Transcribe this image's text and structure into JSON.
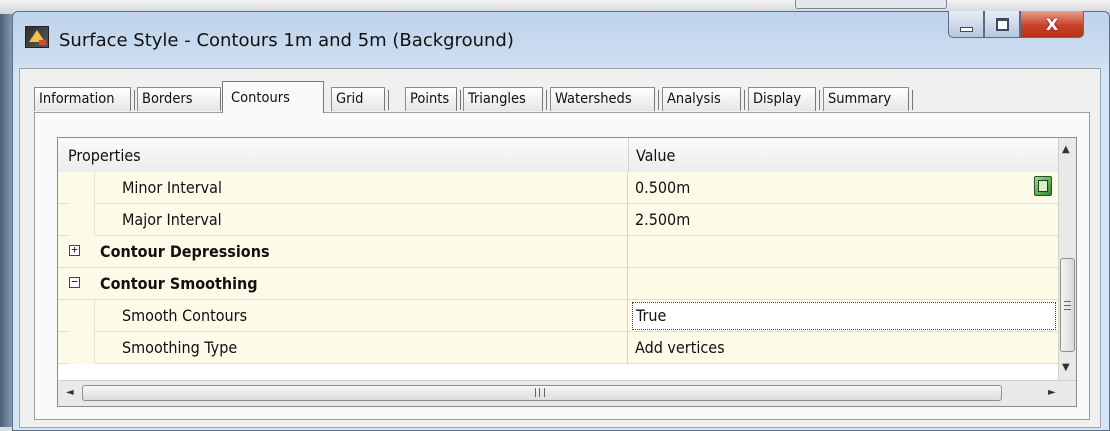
{
  "window": {
    "title": "Surface Style - Contours 1m and 5m (Background)",
    "controls": {
      "close": "X"
    }
  },
  "tabs": [
    {
      "label": "Information",
      "active": false
    },
    {
      "label": "Borders",
      "active": false
    },
    {
      "label": "Contours",
      "active": true
    },
    {
      "label": "Grid",
      "active": false
    },
    {
      "label": "Points",
      "active": false
    },
    {
      "label": "Triangles",
      "active": false
    },
    {
      "label": "Watersheds",
      "active": false
    },
    {
      "label": "Analysis",
      "active": false
    },
    {
      "label": "Display",
      "active": false
    },
    {
      "label": "Summary",
      "active": false
    }
  ],
  "grid": {
    "headers": {
      "property": "Properties",
      "value": "Value"
    },
    "rows": [
      {
        "type": "child",
        "name": "Minor Interval",
        "value": "0.500m",
        "has_pick_button": true
      },
      {
        "type": "child",
        "name": "Major Interval",
        "value": "2.500m"
      },
      {
        "type": "category",
        "name": "Contour Depressions",
        "value": "",
        "expander": "+",
        "expanded": false
      },
      {
        "type": "category",
        "name": "Contour Smoothing",
        "value": "",
        "expander": "−",
        "expanded": true
      },
      {
        "type": "child",
        "name": "Smooth Contours",
        "value": "True",
        "editing": true
      },
      {
        "type": "child",
        "name": "Smoothing Type",
        "value": "Add vertices"
      }
    ]
  },
  "scrollbars": {
    "vertical": {
      "up": "▲",
      "down": "▼"
    },
    "horizontal": {
      "left": "◄",
      "right": "►"
    }
  },
  "colors": {
    "row_background": "#fdfae8",
    "close_button": "#c8432a",
    "title_bar": "#c9dbef"
  }
}
